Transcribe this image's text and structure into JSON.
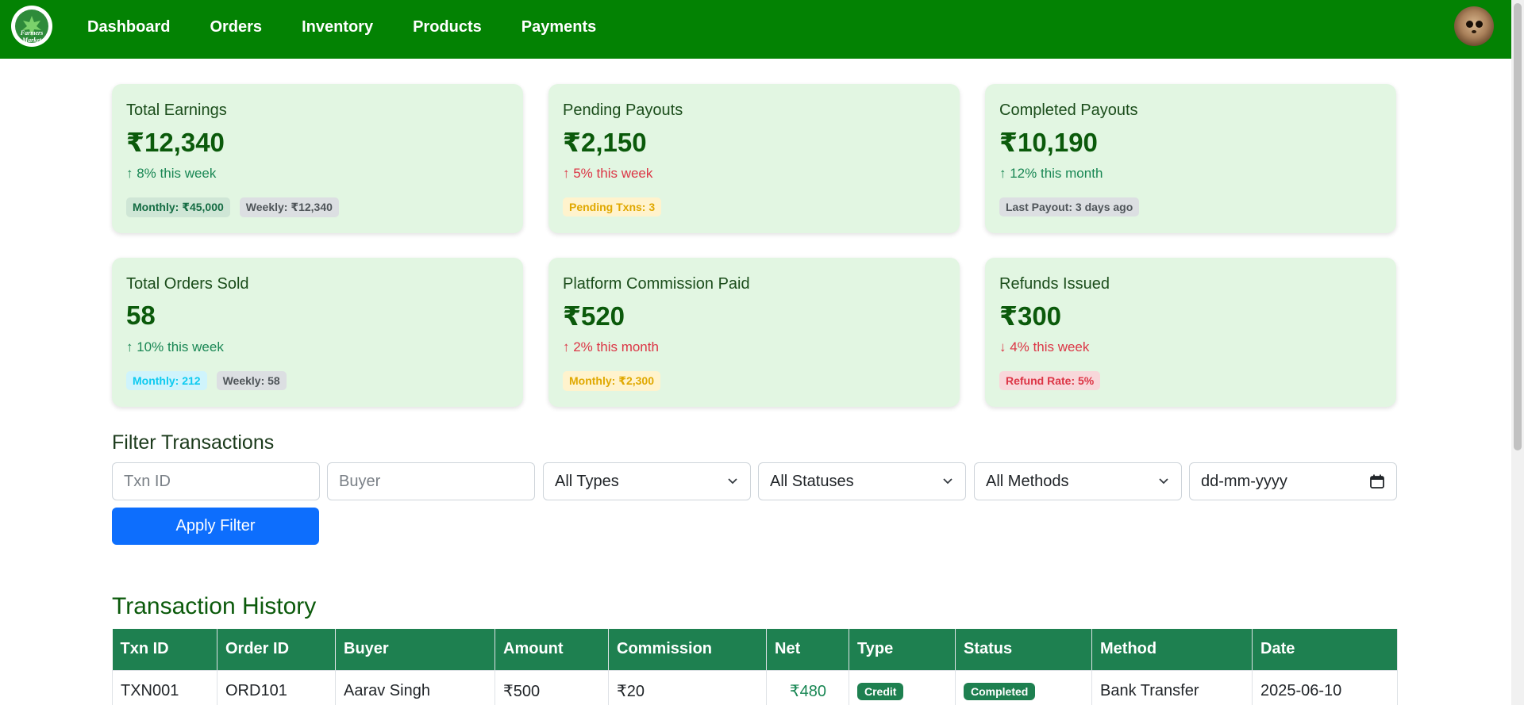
{
  "nav": {
    "logo_text": "Farmers Market",
    "links": [
      "Dashboard",
      "Orders",
      "Inventory",
      "Products",
      "Payments"
    ]
  },
  "cards": [
    {
      "title": "Total Earnings",
      "value": "₹12,340",
      "trend": "↑ 8% this week",
      "trend_color": "#198754",
      "badges": [
        {
          "text": "Monthly: ₹45,000",
          "style": "success"
        },
        {
          "text": "Weekly: ₹12,340",
          "style": "secondary"
        }
      ]
    },
    {
      "title": "Pending Payouts",
      "value": "₹2,150",
      "trend": "↑ 5% this week",
      "trend_color": "#dc3545",
      "badges": [
        {
          "text": "Pending Txns: 3",
          "style": "warning"
        }
      ]
    },
    {
      "title": "Completed Payouts",
      "value": "₹10,190",
      "trend": "↑ 12% this month",
      "trend_color": "#198754",
      "badges": [
        {
          "text": "Last Payout: 3 days ago",
          "style": "secondary"
        }
      ]
    },
    {
      "title": "Total Orders Sold",
      "value": "58",
      "trend": "↑ 10% this week",
      "trend_color": "#198754",
      "badges": [
        {
          "text": "Monthly: 212",
          "style": "info"
        },
        {
          "text": "Weekly: 58",
          "style": "secondary"
        }
      ]
    },
    {
      "title": "Platform Commission Paid",
      "value": "₹520",
      "trend": "↑ 2% this month",
      "trend_color": "#dc3545",
      "badges": [
        {
          "text": "Monthly: ₹2,300",
          "style": "warning"
        }
      ]
    },
    {
      "title": "Refunds Issued",
      "value": "₹300",
      "trend": "↓ 4% this week",
      "trend_color": "#dc3545",
      "badges": [
        {
          "text": "Refund Rate: 5%",
          "style": "danger"
        }
      ]
    }
  ],
  "filter": {
    "title": "Filter Transactions",
    "txn_id_placeholder": "Txn ID",
    "buyer_placeholder": "Buyer",
    "type_selected": "All Types",
    "status_selected": "All Statuses",
    "method_selected": "All Methods",
    "date_placeholder": "dd-mm-yyyy",
    "apply_label": "Apply Filter"
  },
  "table": {
    "title": "Transaction History",
    "columns": [
      "Txn ID",
      "Order ID",
      "Buyer",
      "Amount",
      "Commission",
      "Net",
      "Type",
      "Status",
      "Method",
      "Date"
    ],
    "rows": [
      {
        "txn_id": "TXN001",
        "order_id": "ORD101",
        "buyer": "Aarav Singh",
        "amount": "₹500",
        "commission": "₹20",
        "net": "₹480",
        "type": "Credit",
        "status": "Completed",
        "method": "Bank Transfer",
        "date": "2025-06-10"
      }
    ]
  },
  "colors": {
    "nav_bg": "#038203",
    "card_bg": "#e2f6e2",
    "accent_blue": "#0d6efd",
    "table_header": "#1e8050"
  }
}
